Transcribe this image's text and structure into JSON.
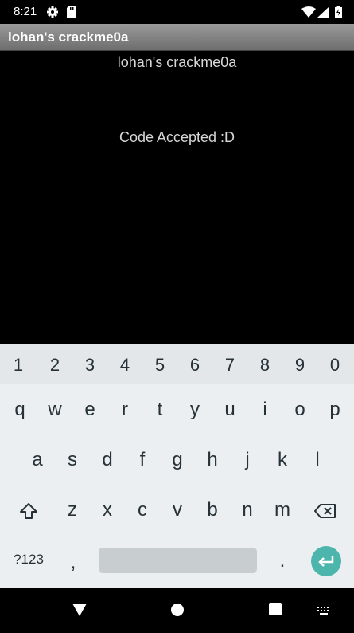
{
  "status_bar": {
    "time": "8:21"
  },
  "app_bar": {
    "title": "lohan's crackme0a"
  },
  "content": {
    "label": "lohan's crackme0a",
    "message": "Code Accepted :D"
  },
  "keyboard": {
    "numbers": [
      "1",
      "2",
      "3",
      "4",
      "5",
      "6",
      "7",
      "8",
      "9",
      "0"
    ],
    "row1": [
      "q",
      "w",
      "e",
      "r",
      "t",
      "y",
      "u",
      "i",
      "o",
      "p"
    ],
    "row2": [
      "a",
      "s",
      "d",
      "f",
      "g",
      "h",
      "j",
      "k",
      "l"
    ],
    "row3": [
      "z",
      "x",
      "c",
      "v",
      "b",
      "n",
      "m"
    ],
    "symbols_label": "?123",
    "comma": ",",
    "period": ".",
    "accent_color": "#4db6ac"
  }
}
